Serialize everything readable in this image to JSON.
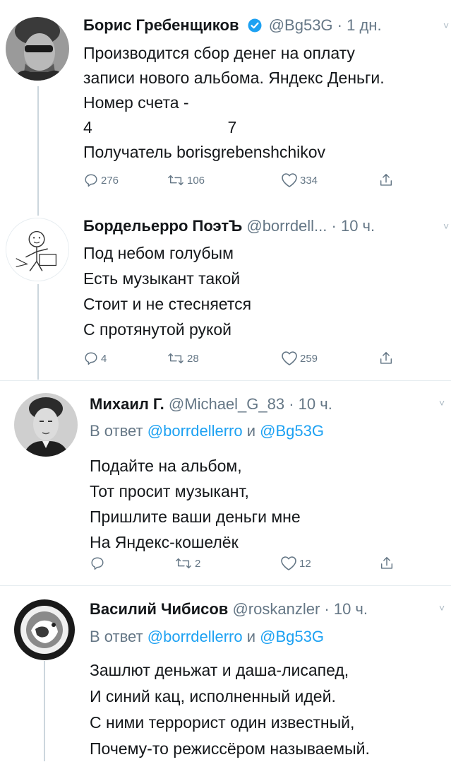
{
  "tweets": [
    {
      "name": "Борис Гребенщиков",
      "handle": "@Bg53G",
      "time": "· 1 дн.",
      "lines": [
        "Производится сбор денег на оплату",
        "записи нового альбома. Яндекс Деньги.",
        "Номер счета -",
        "4                              7",
        "Получатель borisgrebenshchikov"
      ],
      "replies": "276",
      "retweets": "106",
      "likes": "334"
    },
    {
      "name": "Бордельерро ПоэтЪ",
      "handle": "@borrdell...",
      "time": "· 10 ч.",
      "lines": [
        "Под небом голубым",
        "Есть музыкант такой",
        "Стоит и не стесняется",
        "С протянутой рукой"
      ],
      "replies": "4",
      "retweets": "28",
      "likes": "259"
    },
    {
      "name": "Михаил Г.",
      "handle": "@Michael_G_83",
      "time": "· 10 ч.",
      "reply_prefix": "В ответ",
      "reply_user1": "@borrdellerro",
      "reply_and": "и",
      "reply_user2": "@Bg53G",
      "lines": [
        "Подайте на альбом,",
        "Тот просит музыкант,",
        "Пришлите ваши деньги мне",
        "На Яндекс-кошелёк"
      ],
      "replies": "",
      "retweets": "2",
      "likes": "12"
    },
    {
      "name": "Василий Чибисов",
      "handle": "@roskanzler",
      "time": "· 10 ч.",
      "reply_prefix": "В ответ",
      "reply_user1": "@borrdellerro",
      "reply_and": "и",
      "reply_user2": "@Bg53G",
      "lines": [
        "Зашлют деньжат и даша-лисапед,",
        "И синий кац, исполненный идей.",
        "С ними террорист один известный,",
        "Почему-то режиссёром называемый."
      ]
    }
  ],
  "colors": {
    "text": "#14171a",
    "secondary": "#657786",
    "link": "#1da1f2",
    "verified": "#1da1f2",
    "divider": "#e6ecf0"
  }
}
